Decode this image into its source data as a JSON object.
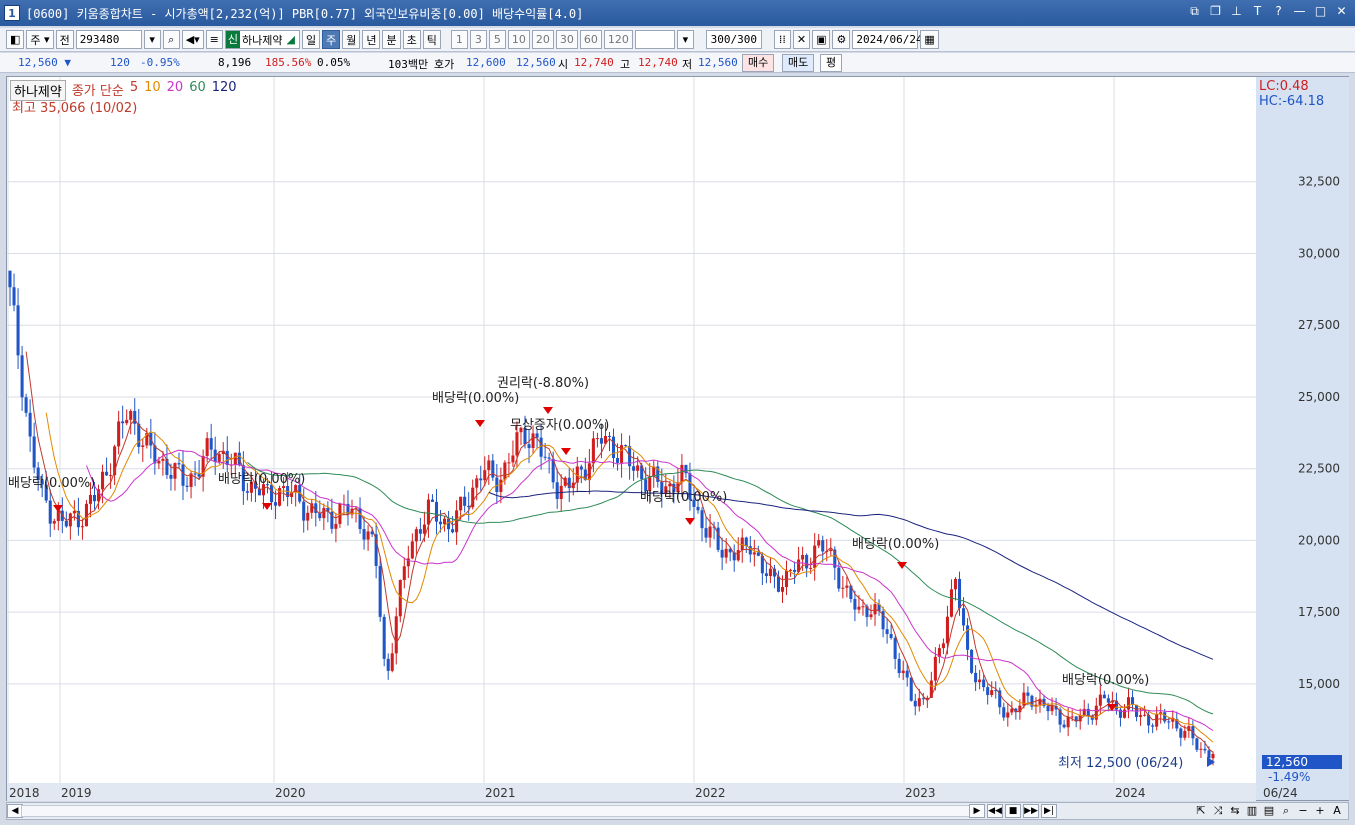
{
  "window": {
    "title_num": "1",
    "title": "[0600] 키움종합차트 - 시가총액[2,232(억)] PBR[0.77] 외국인보유비중[0.00] 배당수익률[4.0]",
    "icons": [
      "restore-icon",
      "copy-icon",
      "pin-icon",
      "T",
      "?",
      "minimize-icon",
      "maximize-icon",
      "close-icon"
    ]
  },
  "toolbar": {
    "period_unit": "주",
    "market": "전",
    "code": "293480",
    "stock_badge": "신",
    "stock_name": "하나제약",
    "periods": [
      "일",
      "주",
      "월",
      "년",
      "분",
      "초",
      "틱"
    ],
    "active_period": "주",
    "intervals": [
      "1",
      "3",
      "5",
      "10",
      "20",
      "30",
      "60",
      "120"
    ],
    "count": "300/300",
    "date": "2024/06/24"
  },
  "quote": {
    "price": "12,560",
    "change": "120",
    "change_pct": "-0.95%",
    "volume": "8,196",
    "vol_ratio": "185.56%",
    "turnover": "0.05%",
    "amount": "103백만",
    "bid_label": "호가",
    "bid1": "12,600",
    "bid2": "12,560",
    "open_label": "시",
    "open": "12,740",
    "high_label": "고",
    "high": "12,740",
    "low_label": "저",
    "low": "12,560",
    "buy": "매수",
    "sell": "매도",
    "even": "평"
  },
  "legend": {
    "name": "하나제약",
    "label": "종가 단순",
    "ma": [
      {
        "period": "5",
        "color": "#c0392b"
      },
      {
        "period": "10",
        "color": "#e08a00"
      },
      {
        "period": "20",
        "color": "#cc33cc"
      },
      {
        "period": "60",
        "color": "#2e8b57"
      },
      {
        "period": "120",
        "color": "#1a237e"
      }
    ],
    "high_note": "최고 35,066 (10/02)",
    "lc": "LC:0.48",
    "hc": "HC:-64.18"
  },
  "chart_data": {
    "type": "candlestick",
    "price_ticks": [
      32500,
      30000,
      27500,
      25000,
      22500,
      20000,
      17500,
      15000
    ],
    "price_labels": [
      "32,500",
      "30,000",
      "27,500",
      "25,000",
      "22,500",
      "20,000",
      "17,500",
      "15,000"
    ],
    "ylim": [
      12000,
      35000
    ],
    "year_labels": [
      "2018",
      "2019",
      "2020",
      "2021",
      "2022",
      "2023",
      "2024"
    ],
    "last_label": "06/24",
    "current_price": "12,560",
    "current_change": "-1.49%",
    "low_note": "최저 12,500 (06/24)",
    "annotations": [
      "배당락(0.00%)",
      "배당락(0.00%)",
      "배당락(0.00%)",
      "권리락(-8.80%)",
      "무상증자(0.00%)",
      "배당락(0.00%)",
      "배당락(0.00%)",
      "배당락(0.00%)"
    ],
    "closes_weekly_sample": [
      28500,
      26000,
      23000,
      21500,
      21000,
      20500,
      20800,
      21000,
      21500,
      22500,
      23500,
      24500,
      23800,
      23000,
      22800,
      22500,
      22000,
      22300,
      22800,
      23200,
      23000,
      22500,
      22000,
      21800,
      21500,
      21800,
      21600,
      21400,
      21000,
      20800,
      20900,
      21000,
      21000,
      20500,
      19500,
      15000,
      17500,
      19500,
      20500,
      21000,
      20800,
      20500,
      21000,
      21800,
      22500,
      22000,
      22500,
      23200,
      23800,
      23500,
      22500,
      22000,
      21800,
      22300,
      23000,
      23500,
      23400,
      23000,
      22500,
      22300,
      22000,
      21800,
      22200,
      22000,
      21000,
      20200,
      19800,
      19600,
      19500,
      20000,
      19000,
      18500,
      18700,
      19000,
      19200,
      19800,
      19600,
      19000,
      18000,
      17500,
      17800,
      17200,
      16500,
      15500,
      14300,
      14500,
      15300,
      16800,
      19000,
      16000,
      15200,
      14800,
      14300,
      14000,
      14200,
      14600,
      14300,
      14000,
      13800,
      13700,
      13900,
      14200,
      14500,
      14100,
      14300,
      13900,
      13800,
      13700,
      13800,
      13400,
      13100,
      12700,
      12560
    ]
  }
}
